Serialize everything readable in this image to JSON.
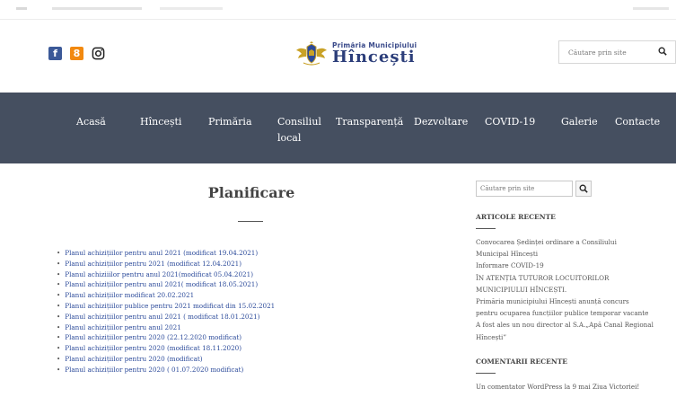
{
  "header": {
    "logo_sub": "Primăria Municipiului",
    "logo_main": "Hîncești",
    "search_placeholder": "Căutare prin site",
    "social": {
      "fb_glyph": "f",
      "ok_glyph": "8"
    }
  },
  "nav": {
    "items": [
      {
        "label": "Acasă"
      },
      {
        "label": "Hîncești"
      },
      {
        "label": "Primăria"
      },
      {
        "label": "Consiliul local"
      },
      {
        "label": "Transparență"
      },
      {
        "label": "Dezvoltare"
      },
      {
        "label": "COVID-19"
      },
      {
        "label": "Galerie"
      },
      {
        "label": "Contacte"
      }
    ]
  },
  "main": {
    "title": "Planificare",
    "plans": [
      "Planul achizițiilor pentru anul 2021 (modificat 19.04.2021)",
      "Planul achizițiilor pentru 2021 (modificat 12.04.2021)",
      "Planul achiziiilor pentru anul 2021(modificat 05.04.2021)",
      "Planul achizițiilor pentru anul 2021( modificat 18.05.2021)",
      "Planul achizițiilor modificat 20.02.2021",
      "Planul achizițiilor publice pentru 2021 modificat din 15.02.2021",
      "Planul achizițiilor pentru anul 2021 ( modificat 18.01.2021)",
      "Planul achizițiilor pentru anul 2021",
      "Planul achizițiilor pentru 2020 (22.12.2020 modificat)",
      "Planul achizițiilor pentru 2020 (modificat 18.11.2020)",
      "Planul achizițiilor pentru 2020 (modificat)",
      "Planul achizițiilor pentru 2020 ( 01.07.2020 modificat)"
    ]
  },
  "sidebar": {
    "search_placeholder": "Căutare prin site",
    "recent_heading": "ARTICOLE RECENTE",
    "recent": [
      "Convocarea Ședinței ordinare a Consiliului",
      "Municipal Hîncești",
      "Informare COVID-19",
      "ÎN ATENȚIA TUTUROR LOCUITORILOR",
      "MUNICIPIULUI HÎNCEȘTI.",
      "Primăria municipiului Hîncești anunță concurs",
      "pentru ocuparea funcțiilor publice temporar vacante",
      "A fost ales un nou director al S.A.„Apă Canal Regional",
      "Hîncești”"
    ],
    "comments_heading": "COMENTARII RECENTE",
    "comment_snippet": "Un comentator WordPress la 9 mai Ziua Victoriei!"
  },
  "colors": {
    "nav_bg": "#454f60",
    "link": "#2b4a9a",
    "facebook": "#3b5998",
    "odnoklassniki": "#f2890f"
  }
}
